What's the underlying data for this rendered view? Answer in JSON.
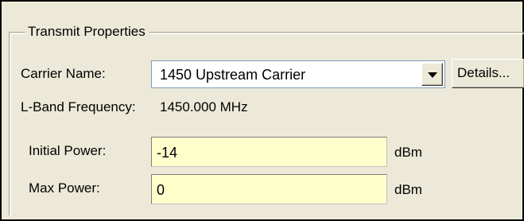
{
  "group": {
    "title": "Transmit Properties"
  },
  "carrier": {
    "label": "Carrier Name:",
    "value": "1450 Upstream Carrier",
    "details_label": "Details..."
  },
  "lband": {
    "label": "L-Band Frequency:",
    "value": "1450.000 MHz"
  },
  "initial_power": {
    "label": "Initial Power:",
    "value": "-14",
    "unit": "dBm"
  },
  "max_power": {
    "label": "Max Power:",
    "value": "0",
    "unit": "dBm"
  },
  "colors": {
    "field_background": "#ffffcc",
    "dialog_background": "#ece9d8"
  },
  "icons": {
    "dropdown": "chevron-down-icon"
  }
}
